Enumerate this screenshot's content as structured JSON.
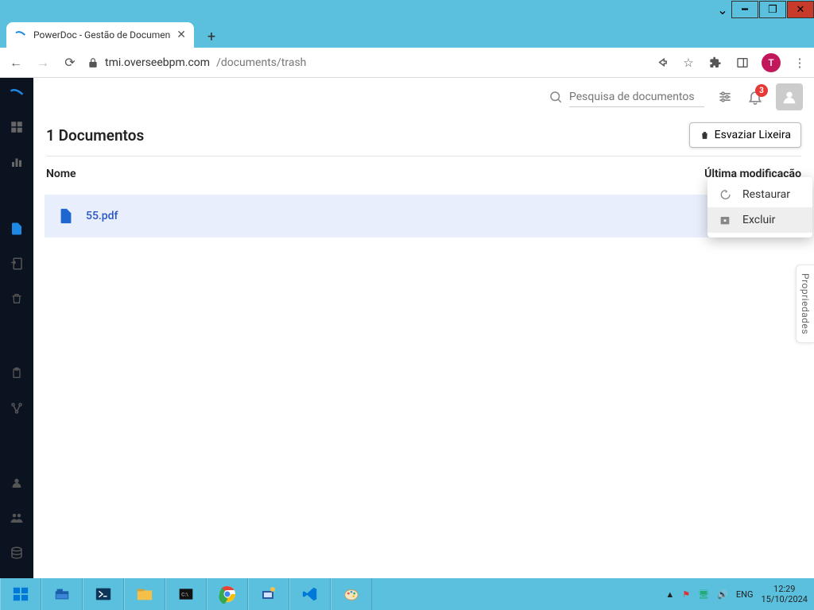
{
  "window": {
    "tab_title": "PowerDoc - Gestão de Documen",
    "url_domain": "tmi.overseebpm.com",
    "url_path": "/documents/trash",
    "avatar_letter": "T"
  },
  "topbar": {
    "search_placeholder": "Pesquisa de documentos",
    "notification_count": "3"
  },
  "page": {
    "title": "1 Documentos",
    "empty_trash_label": "Esvaziar Lixeira",
    "col_name": "Nome",
    "col_modified": "Última modificação",
    "properties_label": "Propriedades"
  },
  "rows": [
    {
      "filename": "55.pdf"
    }
  ],
  "context_menu": {
    "restore": "Restaurar",
    "delete": "Excluir"
  },
  "taskbar": {
    "lang": "ENG",
    "time": "12:29",
    "date": "15/10/2024"
  }
}
